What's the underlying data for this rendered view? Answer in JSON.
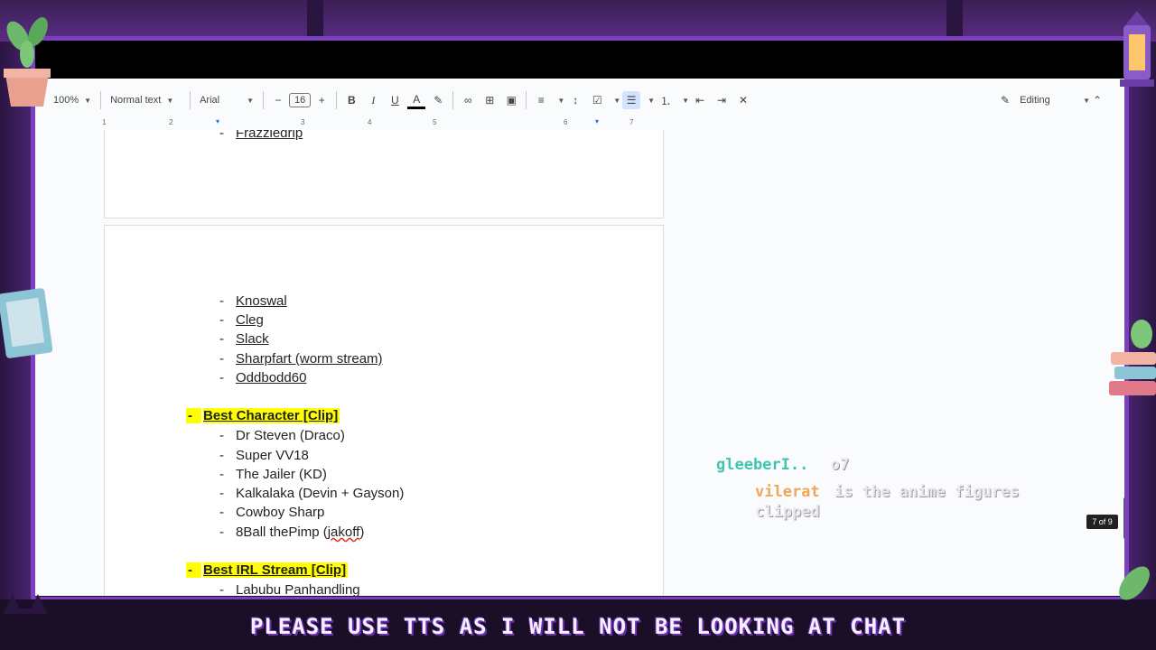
{
  "toolbar": {
    "zoom": "100%",
    "style": "Normal text",
    "font": "Arial",
    "font_size": "16",
    "mode": "Editing"
  },
  "ruler": {
    "ticks": [
      "1",
      "2",
      "3",
      "4",
      "5",
      "6",
      "7"
    ]
  },
  "page1": {
    "partial_item": "Frazzledrip"
  },
  "page2": {
    "list1": [
      "Knoswal",
      "Cleg",
      "Slack",
      "Sharpfart (worm stream)",
      "Oddbodd60"
    ],
    "section_best_character": "Best Character [Clip]",
    "list_character": [
      "Dr Steven (Draco)",
      "Super VV18",
      "The Jailer (KD)",
      "Kalkalaka (Devin + Gayson)",
      "Cowboy Sharp"
    ],
    "pimp_prefix": "8Ball thePimp (",
    "pimp_spell": "jakoff",
    "pimp_suffix": ")",
    "section_best_irl": "Best IRL Stream [Clip]",
    "list_irl": [
      "Labubu Panhandling"
    ]
  },
  "page_indicator": "7 of 9",
  "chat": [
    {
      "user": "gleeberI..",
      "message": "o7"
    },
    {
      "user": "vilerat",
      "message": "is the anime figures clipped"
    }
  ],
  "banner": "PLEASE USE TTS AS I WILL NOT BE LOOKING AT CHAT",
  "colors": {
    "highlight": "#ffff00",
    "frame": "#7b3fc0",
    "chat_user1": "#3fc5b0",
    "chat_user2": "#f2a65a"
  }
}
